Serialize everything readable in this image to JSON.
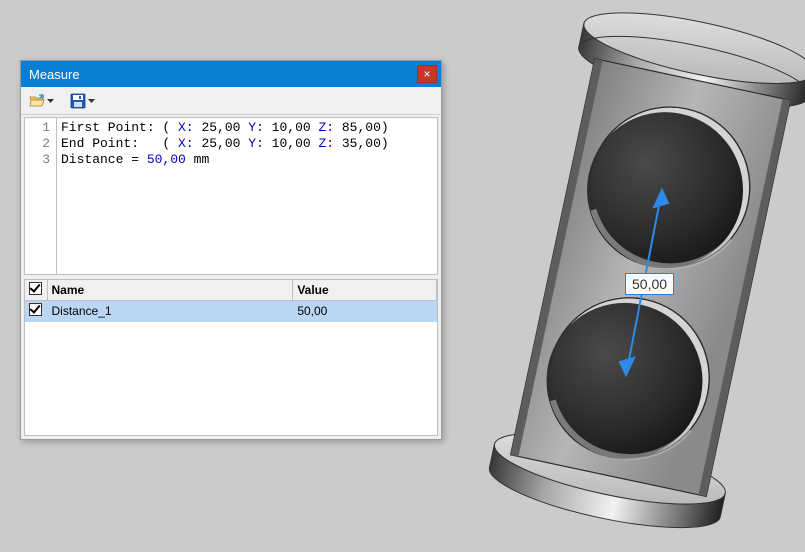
{
  "dialog": {
    "title": "Measure",
    "close": "×",
    "toolbar": {
      "open_tooltip": "Open",
      "save_tooltip": "Save"
    },
    "code": {
      "lines": [
        {
          "n": "1",
          "prefix": "First Point: ( ",
          "parts": [
            "X:",
            " 25,00 ",
            "Y:",
            " 10,00 ",
            "Z:",
            " 85,00)"
          ]
        },
        {
          "n": "2",
          "prefix": "End Point:   ( ",
          "parts": [
            "X:",
            " 25,00 ",
            "Y:",
            " 10,00 ",
            "Z:",
            " 35,00)"
          ]
        },
        {
          "n": "3",
          "prefix": "Distance = ",
          "value": "50,00",
          "unit": " mm"
        }
      ]
    },
    "table": {
      "headers": {
        "name": "Name",
        "value": "Value"
      },
      "rows": [
        {
          "checked": true,
          "name": "Distance_1",
          "value": "50,00",
          "selected": true
        }
      ]
    }
  },
  "viewport": {
    "dimension_label": "50,00"
  }
}
